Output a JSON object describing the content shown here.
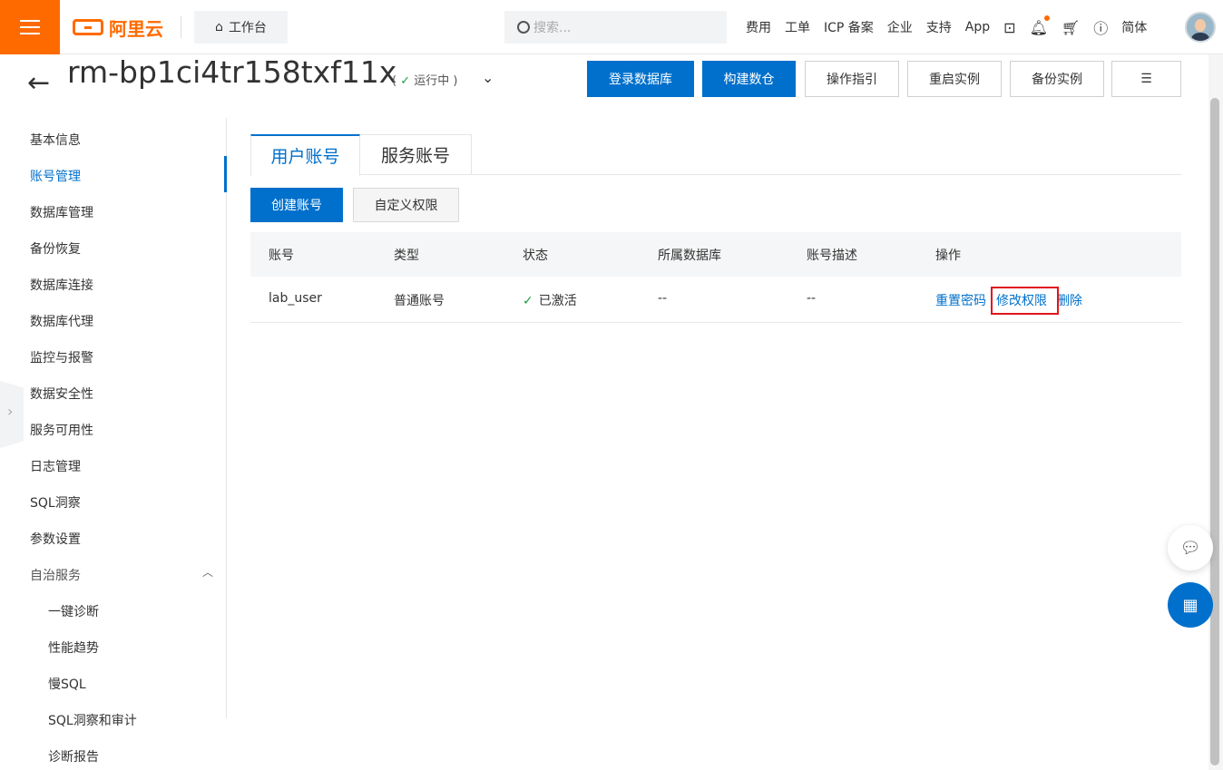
{
  "topbar": {
    "brand": "阿里云",
    "workbench": "工作台",
    "search_placeholder": "搜索...",
    "nav": [
      "费用",
      "工单",
      "ICP 备案",
      "企业",
      "支持",
      "App"
    ],
    "lang": "简体"
  },
  "header": {
    "instance_id": "rm-bp1ci4tr158txf11x",
    "status_open": "(",
    "status_text": "运行中",
    "status_close": ")",
    "buttons": [
      "登录数据库",
      "构建数仓",
      "操作指引",
      "重启实例",
      "备份实例"
    ]
  },
  "sidebar": {
    "items": [
      "基本信息",
      "账号管理",
      "数据库管理",
      "备份恢复",
      "数据库连接",
      "数据库代理",
      "监控与报警",
      "数据安全性",
      "服务可用性",
      "日志管理",
      "SQL洞察",
      "参数设置",
      "自治服务"
    ],
    "sub_items": [
      "一键诊断",
      "性能趋势",
      "慢SQL",
      "SQL洞察和审计",
      "诊断报告"
    ]
  },
  "tabs": [
    "用户账号",
    "服务账号"
  ],
  "actions": {
    "create": "创建账号",
    "custom": "自定义权限"
  },
  "table": {
    "columns": [
      "账号",
      "类型",
      "状态",
      "所属数据库",
      "账号描述",
      "操作"
    ],
    "rows": [
      {
        "account": "lab_user",
        "type": "普通账号",
        "status": "已激活",
        "database": "--",
        "description": "--",
        "ops": [
          "重置密码",
          "修改权限",
          "删除"
        ]
      }
    ]
  },
  "colors": {
    "primary": "#0070cc",
    "brand": "#ff6a00",
    "success": "#1e9e3f",
    "highlight": "#e0151b"
  }
}
